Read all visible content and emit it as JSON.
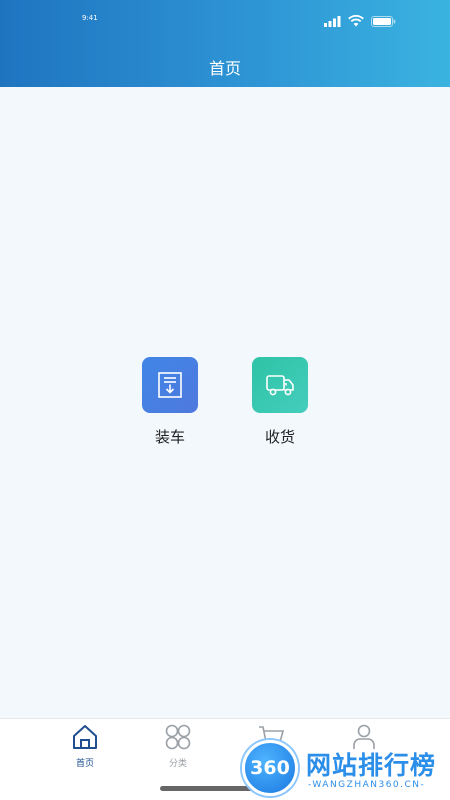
{
  "status_bar": {
    "time": "9:41"
  },
  "header": {
    "title": "首页"
  },
  "tiles": [
    {
      "label": "装车",
      "icon": "download-box-icon",
      "color": "#4a82e4"
    },
    {
      "label": "收货",
      "icon": "truck-icon",
      "color": "#36c6ad"
    }
  ],
  "tabbar": {
    "items": [
      {
        "label": "首页",
        "icon": "home-icon",
        "active": true
      },
      {
        "label": "分类",
        "icon": "grid-icon",
        "active": false
      },
      {
        "label": "",
        "icon": "cart-icon",
        "active": false
      },
      {
        "label": "",
        "icon": "user-icon",
        "active": false
      }
    ]
  },
  "watermark": {
    "badge": "360",
    "text": "网站排行榜",
    "sub": "-WANGZHAN360.CN-"
  },
  "colors": {
    "header_start": "#1f74c0",
    "header_end": "#3ab3e0",
    "active_tab": "#1f4f8f"
  }
}
